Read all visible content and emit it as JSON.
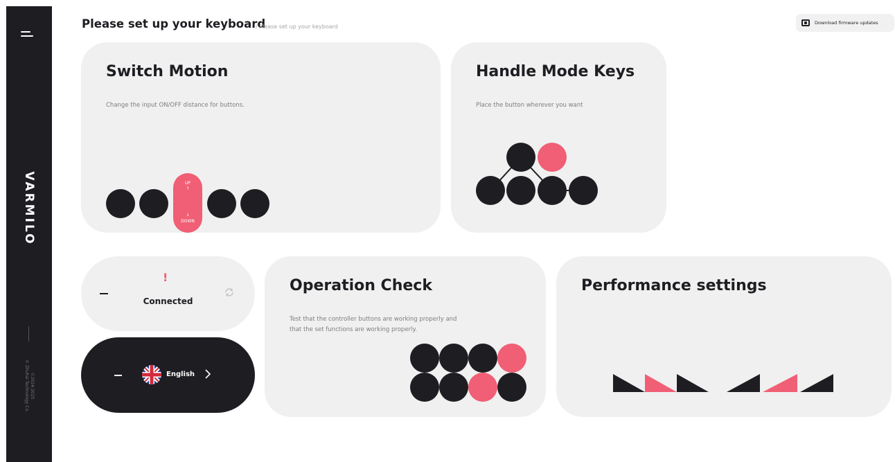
{
  "sidebar": {
    "brand": "VARMILO",
    "copyright_line1": "©2024-2025",
    "copyright_line2": "© Zhuhai Technology Co."
  },
  "header": {
    "title": "Please set up your keyboard",
    "subtitle": "/ Please set up your keyboard",
    "download_label": "Download firmware updates"
  },
  "cards": {
    "switch_motion": {
      "title": "Switch Motion",
      "description": "Change the input ON/OFF distance for buttons.",
      "up_label": "UP",
      "down_label": "DOWN"
    },
    "handle_mode": {
      "title": "Handle Mode Keys",
      "description": "Place the button wherever you want"
    },
    "connection": {
      "alert": "!",
      "status": "Connected"
    },
    "language": {
      "label": "English"
    },
    "operation_check": {
      "title": "Operation Check",
      "description_line1": "Test that the controller buttons are working properly and",
      "description_line2": "that the set functions are working properly."
    },
    "performance": {
      "title": "Performance settings"
    }
  },
  "colors": {
    "dark": "#1e1d22",
    "accent": "#f05f75",
    "card_bg": "#f0f0f0"
  },
  "icons": [
    "menu-icon",
    "download-icon",
    "refresh-icon",
    "uk-flag-icon",
    "chevron-right-icon"
  ]
}
